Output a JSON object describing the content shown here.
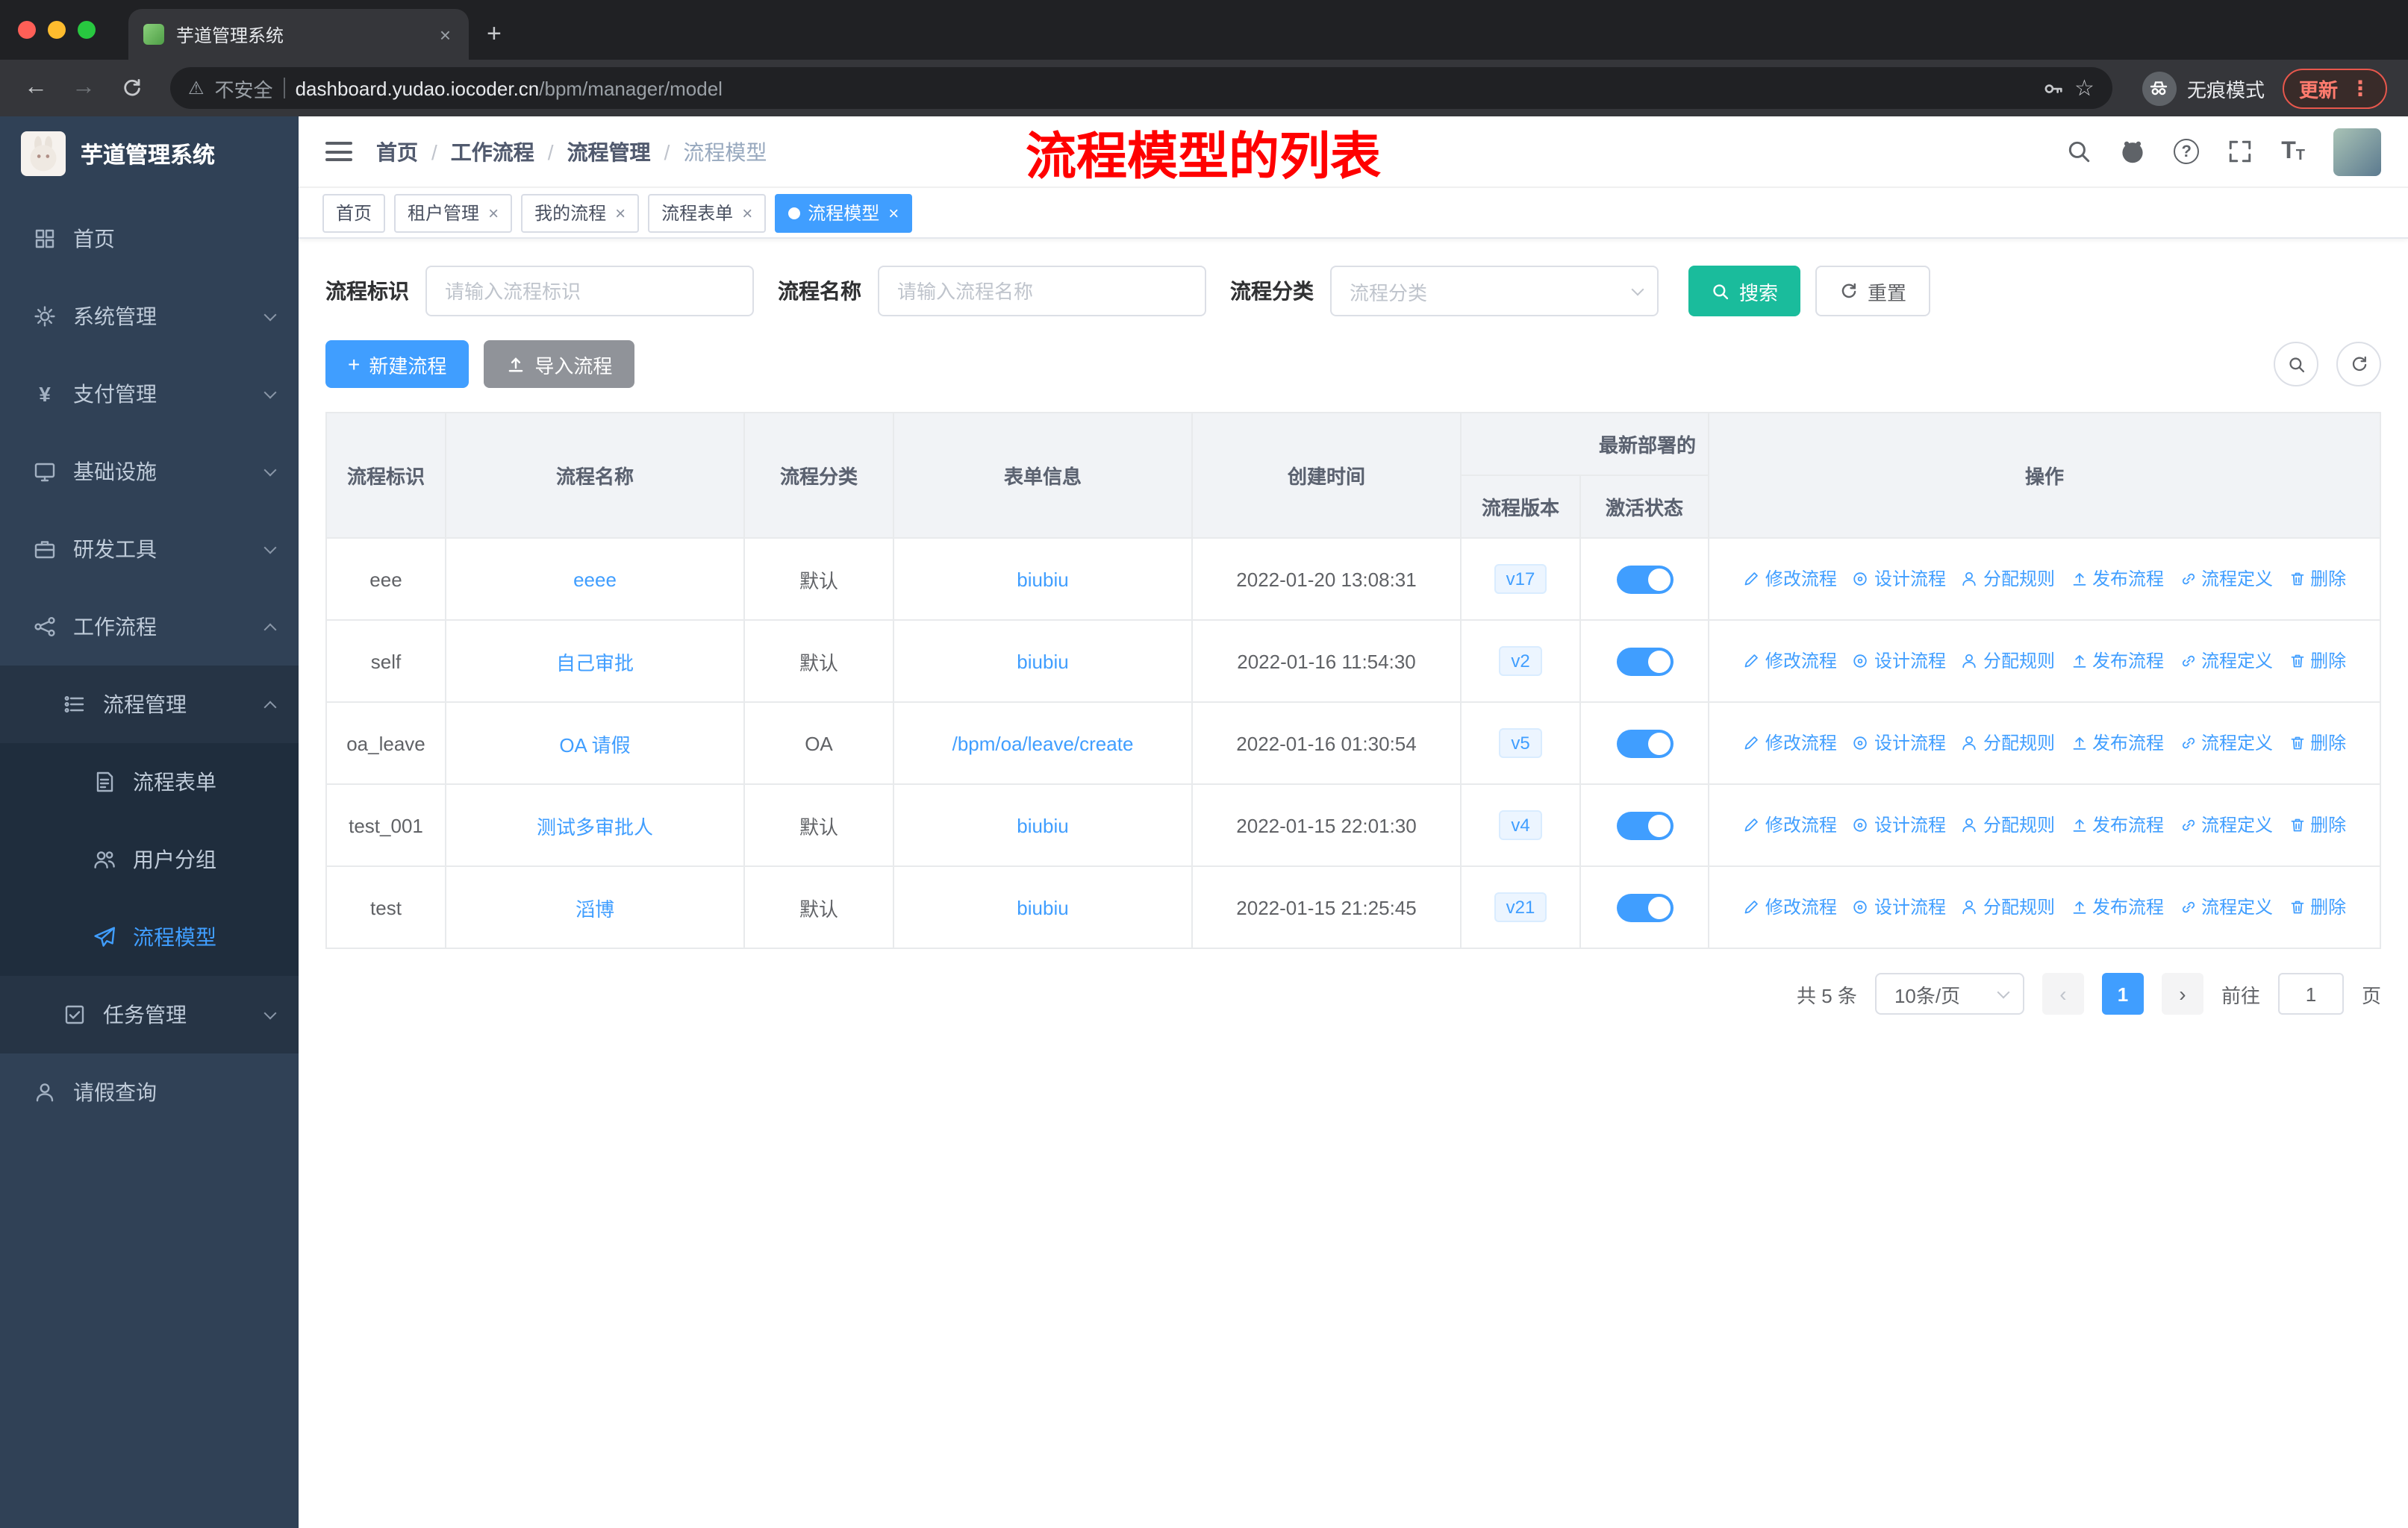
{
  "colors": {
    "primary": "#409EFF",
    "teal": "#1ABC9C",
    "annotation": "#FF0000",
    "sidebar_bg": "#304156",
    "sidebar_sub": "#263445",
    "sidebar_subsub": "#1F2D3D",
    "import_gray": "#909399"
  },
  "icons": {
    "close": "×",
    "plus": "+",
    "back": "←",
    "forward": "→",
    "overflow": "⋮",
    "star": "☆",
    "warning": "⚠",
    "pager_prev": "‹",
    "pager_next": "›",
    "yen": "¥",
    "help": "?",
    "text_size": "T",
    "slash": "/"
  },
  "browser": {
    "tab_title": "芋道管理系统",
    "security_text": "不安全",
    "url_host": "dashboard.yudao.iocoder.cn",
    "url_path": "/bpm/manager/model",
    "incognito_label": "无痕模式",
    "update_label": "更新"
  },
  "sidebar": {
    "logo_title": "芋道管理系统",
    "menu": [
      {
        "label": "首页"
      },
      {
        "label": "系统管理"
      },
      {
        "label": "支付管理"
      },
      {
        "label": "基础设施"
      },
      {
        "label": "研发工具"
      },
      {
        "label": "工作流程"
      },
      {
        "label": "流程管理"
      },
      {
        "label": "流程表单"
      },
      {
        "label": "用户分组"
      },
      {
        "label": "流程模型"
      },
      {
        "label": "任务管理"
      },
      {
        "label": "请假查询"
      }
    ]
  },
  "header": {
    "breadcrumb": [
      "首页",
      "工作流程",
      "流程管理",
      "流程模型"
    ],
    "annotation": "流程模型的列表"
  },
  "tags": [
    {
      "label": "首页"
    },
    {
      "label": "租户管理"
    },
    {
      "label": "我的流程"
    },
    {
      "label": "流程表单"
    },
    {
      "label": "流程模型"
    }
  ],
  "filters": {
    "key_label": "流程标识",
    "key_placeholder": "请输入流程标识",
    "name_label": "流程名称",
    "name_placeholder": "请输入流程名称",
    "category_label": "流程分类",
    "category_placeholder": "流程分类",
    "search_label": "搜索",
    "reset_label": "重置"
  },
  "toolbar": {
    "create_label": "新建流程",
    "import_label": "导入流程"
  },
  "table": {
    "headers": {
      "key": "流程标识",
      "name": "流程名称",
      "category": "流程分类",
      "form": "表单信息",
      "created": "创建时间",
      "deploy_group": "最新部署的",
      "version": "流程版本",
      "status": "激活状态",
      "actions": "操作"
    },
    "action_labels": [
      "修改流程",
      "设计流程",
      "分配规则",
      "发布流程",
      "流程定义",
      "删除"
    ],
    "rows": [
      {
        "key": "eee",
        "name": "eeee",
        "category": "默认",
        "form": "biubiu",
        "created": "2022-01-20 13:08:31",
        "version": "v17",
        "active": true
      },
      {
        "key": "self",
        "name": "自己审批",
        "category": "默认",
        "form": "biubiu",
        "created": "2022-01-16 11:54:30",
        "version": "v2",
        "active": true
      },
      {
        "key": "oa_leave",
        "name": "OA 请假",
        "category": "OA",
        "form": "/bpm/oa/leave/create",
        "created": "2022-01-16 01:30:54",
        "version": "v5",
        "active": true
      },
      {
        "key": "test_001",
        "name": "测试多审批人",
        "category": "默认",
        "form": "biubiu",
        "created": "2022-01-15 22:01:30",
        "version": "v4",
        "active": true
      },
      {
        "key": "test",
        "name": "滔博",
        "category": "默认",
        "form": "biubiu",
        "created": "2022-01-15 21:25:45",
        "version": "v21",
        "active": true
      }
    ]
  },
  "pagination": {
    "total_text": "共 5 条",
    "page_size_text": "10条/页",
    "current_page": "1",
    "goto_label": "前往",
    "goto_value": "1",
    "page_unit": "页"
  }
}
